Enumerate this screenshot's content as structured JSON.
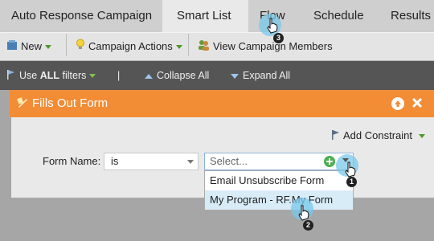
{
  "tabs": [
    {
      "label": "Auto Response Campaign"
    },
    {
      "label": "Smart List"
    },
    {
      "label": "Flow"
    },
    {
      "label": "Schedule"
    },
    {
      "label": "Results"
    }
  ],
  "toolbar": {
    "new_label": "New",
    "campaign_actions_label": "Campaign Actions",
    "view_members_label": "View Campaign Members"
  },
  "filterbar": {
    "use_filters_prefix": "Use",
    "use_filters_bold": "ALL",
    "use_filters_suffix": "filters",
    "separator": "|",
    "collapse_label": "Collapse All",
    "expand_label": "Expand All"
  },
  "filter_panel": {
    "title": "Fills Out Form",
    "add_constraint_label": "Add Constraint",
    "field_label": "Form Name:",
    "operator_value": "is",
    "value_placeholder": "Select...",
    "options": [
      "Email Unsubscribe Form",
      "My Program - RF.My Form"
    ]
  },
  "step_markers": [
    "1",
    "2",
    "3"
  ],
  "colors": {
    "accent_orange": "#f28c35",
    "highlight_blue": "#d8ecf8",
    "add_green": "#4caf50"
  }
}
